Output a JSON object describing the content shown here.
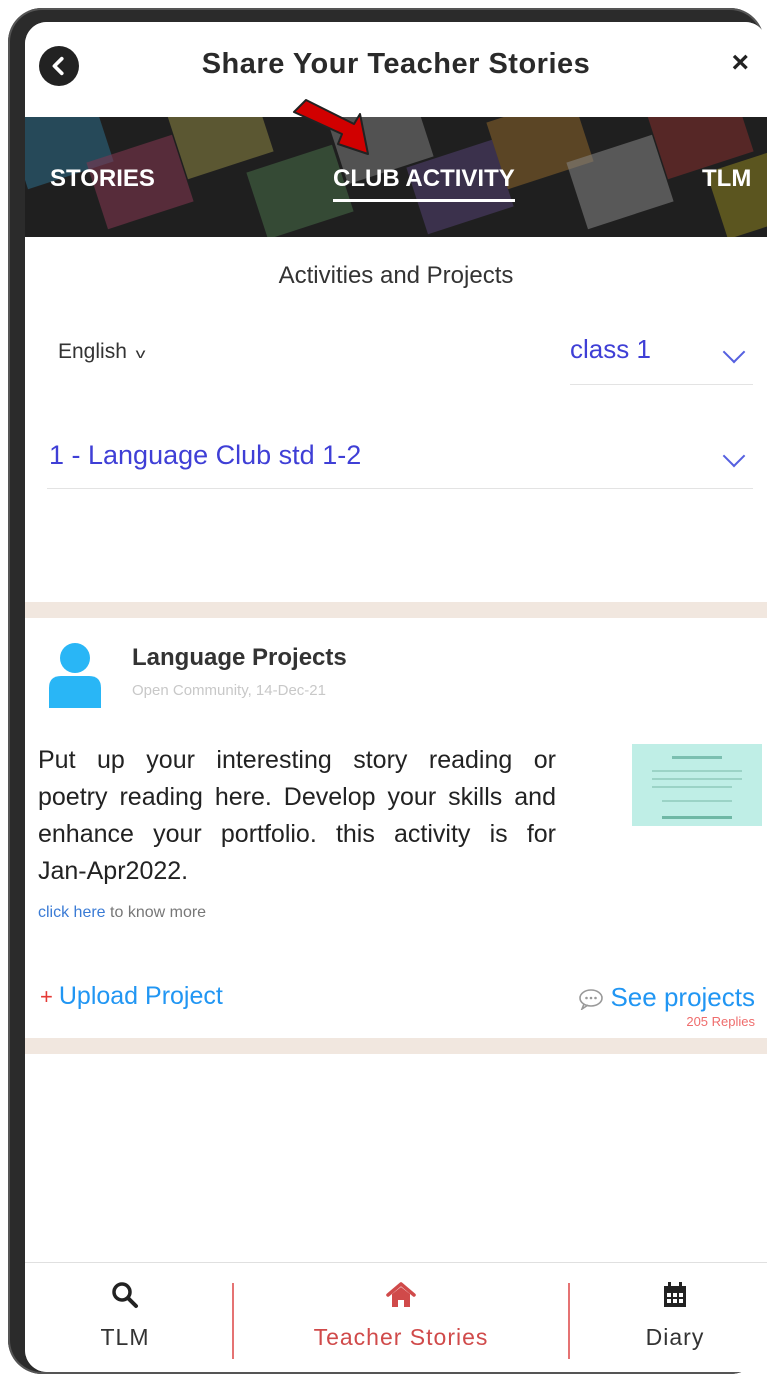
{
  "header": {
    "title": "Share Your Teacher Stories",
    "close_label": "×"
  },
  "tabs": [
    {
      "label": "STORIES"
    },
    {
      "label": "CLUB ACTIVITY",
      "active": true
    },
    {
      "label": "TLM"
    }
  ],
  "section": {
    "heading": "Activities and Projects"
  },
  "filters": {
    "language": "English",
    "class": "class 1",
    "club": "1 - Language Club std 1-2"
  },
  "card": {
    "title": "Language Projects",
    "meta": "Open Community, 14-Dec-21",
    "body_lines": [
      "Put up your interesting story reading or",
      "poetry reading here. Develop your skills and",
      "enhance your portfolio. this activity is for",
      "Jan-Apr2022."
    ],
    "link_text": "click here",
    "link_suffix": " to know more",
    "upload_plus": "+",
    "upload_label": "Upload Project",
    "see_label": "See projects",
    "replies": "205 Replies"
  },
  "bottom_nav": [
    {
      "label": "TLM",
      "icon": "search-icon"
    },
    {
      "label": "Teacher Stories",
      "icon": "home-icon",
      "active": true
    },
    {
      "label": "Diary",
      "icon": "calendar-icon"
    }
  ],
  "colors": {
    "accent_blue": "#3f3fd6",
    "link_blue": "#2196f3",
    "avatar": "#29b6f6",
    "active_nav": "#d04a4a",
    "arrow": "#d10000",
    "band": "#f1e7df"
  }
}
